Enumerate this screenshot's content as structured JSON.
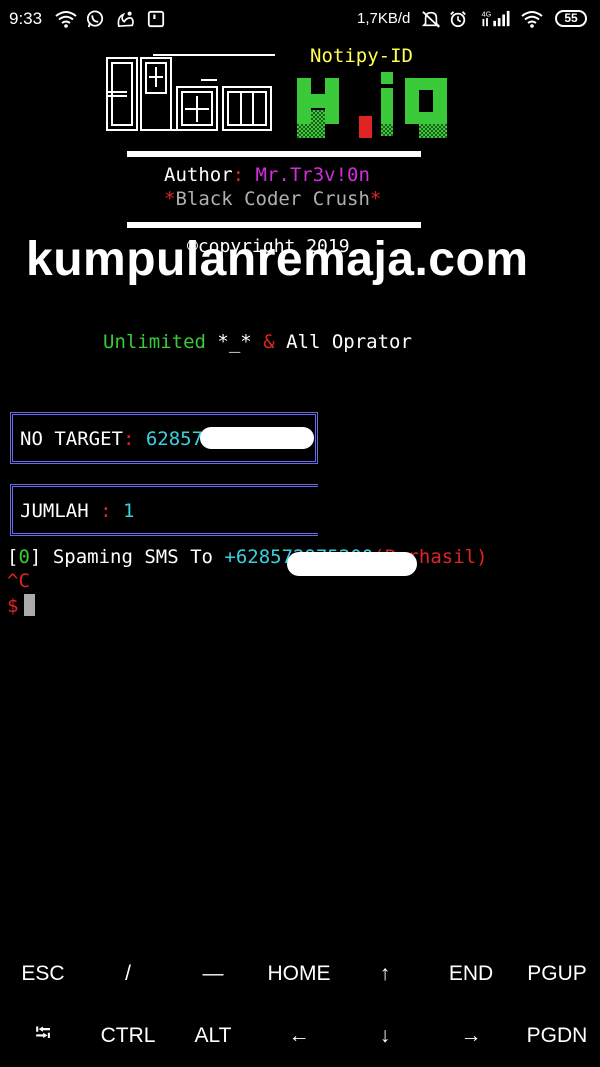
{
  "status_bar": {
    "time": "9:33",
    "net_speed": "1,7KB/d",
    "network_type": "4G",
    "battery": "55",
    "icons": [
      "wifi-icon",
      "whatsapp-icon",
      "uc-browser-icon",
      "screenshot-icon",
      "mute-icon",
      "alarm-icon",
      "signal-icon",
      "wifi-icon",
      "battery-icon"
    ]
  },
  "banner": {
    "logo_text": "SPam",
    "tool_name": "Notipy-ID",
    "logo_right_text": "H.iD",
    "author_label": "Author",
    "author_sep": ":",
    "author_name": "Mr.Tr3v!0n",
    "tagline_star_l": "*",
    "tagline": "Black Coder Crush",
    "tagline_star_r": "*",
    "copyright": "©copyright 2019"
  },
  "watermark": "kumpulanremaja.com",
  "info_line": {
    "unlimited": "Unlimited",
    "face": "*_*",
    "amp": "&",
    "operators": "All Oprator"
  },
  "target_box": {
    "label": "NO TARGET",
    "sep": ":",
    "value": "62857297520"
  },
  "count_box": {
    "label": "JUMLAH",
    "sep": ":",
    "value": "1"
  },
  "output": {
    "bracket_l": "[",
    "index": "0",
    "bracket_r": "]",
    "text": "Spaming SMS To",
    "number": "+628572975200",
    "result": "(Berhasil)",
    "interrupt": "^C",
    "prompt": "$"
  },
  "extra_keys": {
    "row1": [
      "ESC",
      "/",
      "—",
      "HOME",
      "↑",
      "END",
      "PGUP"
    ],
    "row2": [
      "⭾",
      "CTRL",
      "ALT",
      "←",
      "↓",
      "→",
      "PGDN"
    ]
  },
  "colors": {
    "background": "#000000",
    "green": "#39c939",
    "red": "#e02424",
    "cyan": "#3bd0e0",
    "magenta": "#d22ed9",
    "yellow": "#ffff55",
    "box_border": "#6a6ae6"
  }
}
